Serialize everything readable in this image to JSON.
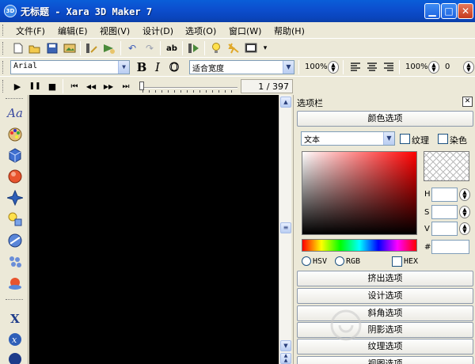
{
  "window": {
    "title": "无标题 - Xara 3D Maker 7",
    "icon_label": "3D",
    "minimize": "▁",
    "maximize": "□",
    "close": "✕"
  },
  "menu": [
    "文件(F)",
    "编辑(E)",
    "视图(V)",
    "设计(D)",
    "选项(O)",
    "窗口(W)",
    "帮助(H)"
  ],
  "toolbar": {
    "undo_label": "↶",
    "redo_label": "↷",
    "spell_label": "ab",
    "overflow": "▾"
  },
  "format": {
    "font": "Arial",
    "bold": "B",
    "italic": "I",
    "outline": "O",
    "fit": "适合宽度",
    "zoom1": "100%",
    "zoom2": "100%",
    "value3": "0"
  },
  "animation": {
    "frame_counter": "1 / 397",
    "play": "▶",
    "pause": "❚❚",
    "stop": "■",
    "first": "⏮",
    "prev": "◀◀",
    "next": "▶▶",
    "last": "⏭",
    "position": 0.0
  },
  "left_tools": {
    "text_tool": "Aa"
  },
  "panel": {
    "title": "选项栏",
    "close": "✕",
    "color_button": "颜色选项",
    "target_select": "文本",
    "texture_label": "纹理",
    "dye_label": "染色",
    "hsv_labels": {
      "h": "H",
      "s": "S",
      "v": "V"
    },
    "hash_label": "#",
    "mode_labels": {
      "hsv": "HSV",
      "rgb": "RGB",
      "hex": "HEX"
    },
    "buttons": [
      "挤出选项",
      "设计选项",
      "斜角选项",
      "阴影选项",
      "纹理选项",
      "视图选项"
    ]
  },
  "colors": {
    "titlebar": "#0a50cc",
    "face": "#ece9d8",
    "canvas": "#000000"
  }
}
